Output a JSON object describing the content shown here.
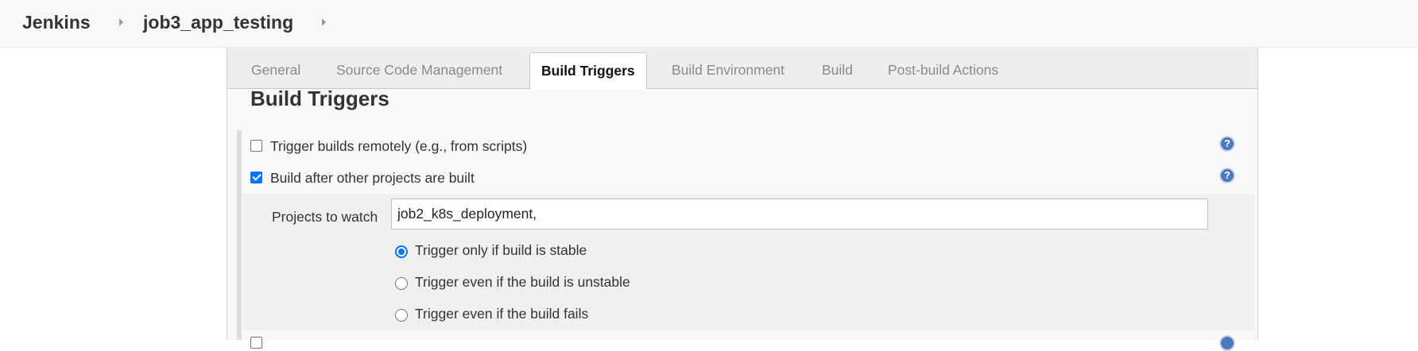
{
  "breadcrumb": {
    "home": "Jenkins",
    "job": "job3_app_testing"
  },
  "tabs": [
    {
      "label": "General"
    },
    {
      "label": "Source Code Management"
    },
    {
      "label": "Build Triggers"
    },
    {
      "label": "Build Environment"
    },
    {
      "label": "Build"
    },
    {
      "label": "Post-build Actions"
    }
  ],
  "active_tab": "Build Triggers",
  "section": {
    "title": "Build Triggers",
    "options": [
      {
        "label": "Trigger builds remotely (e.g., from scripts)",
        "checked": false
      },
      {
        "label": "Build after other projects are built",
        "checked": true
      }
    ],
    "projects_to_watch": {
      "label": "Projects to watch",
      "value": "job2_k8s_deployment,"
    },
    "radios": [
      {
        "label": "Trigger only if build is stable",
        "selected": true
      },
      {
        "label": "Trigger even if the build is unstable",
        "selected": false
      },
      {
        "label": "Trigger even if the build fails",
        "selected": false
      }
    ]
  },
  "icons": {
    "help": "question-mark-circle-icon",
    "breadcrumb_separator": "chevron-right-icon"
  },
  "colors": {
    "accent": "#0075ff",
    "help_icon": "#4a78b8"
  }
}
